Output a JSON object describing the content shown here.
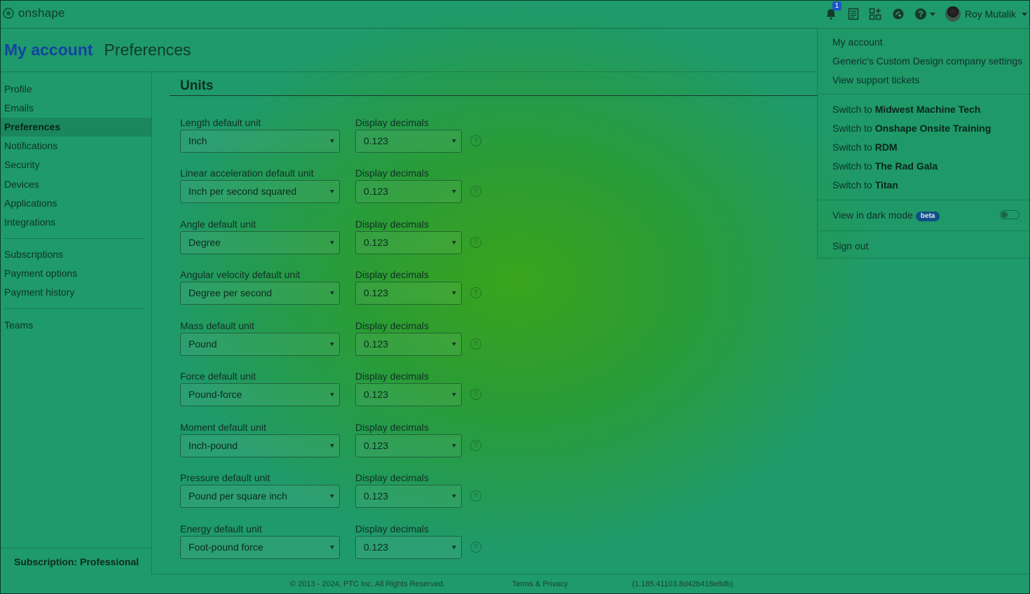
{
  "app": {
    "logo_text": "onshape"
  },
  "topbar": {
    "notification_count": "1",
    "user_name": "Roy Mutalik",
    "icons": [
      "bell-icon",
      "document-list-icon",
      "app-store-icon",
      "learning-center-icon",
      "help-icon",
      "user-avatar"
    ]
  },
  "header": {
    "title": "My account",
    "subtitle": "Preferences"
  },
  "sidebar": {
    "groups": [
      [
        "Profile",
        "Emails",
        "Preferences",
        "Notifications",
        "Security",
        "Devices",
        "Applications",
        "Integrations"
      ],
      [
        "Subscriptions",
        "Payment options",
        "Payment history"
      ],
      [
        "Teams"
      ]
    ],
    "active": "Preferences",
    "subscription": "Subscription: Professional"
  },
  "units": {
    "title": "Units",
    "rows": [
      {
        "label": "Length default unit",
        "value": "Inch",
        "dec_label": "Display decimals",
        "decimals": "0.123"
      },
      {
        "label": "Linear acceleration default unit",
        "value": "Inch per second squared",
        "dec_label": "Display decimals",
        "decimals": "0.123"
      },
      {
        "label": "Angle default unit",
        "value": "Degree",
        "dec_label": "Display decimals",
        "decimals": "0.123"
      },
      {
        "label": "Angular velocity default unit",
        "value": "Degree per second",
        "dec_label": "Display decimals",
        "decimals": "0.123"
      },
      {
        "label": "Mass default unit",
        "value": "Pound",
        "dec_label": "Display decimals",
        "decimals": "0.123"
      },
      {
        "label": "Force default unit",
        "value": "Pound-force",
        "dec_label": "Display decimals",
        "decimals": "0.123"
      },
      {
        "label": "Moment default unit",
        "value": "Inch-pound",
        "dec_label": "Display decimals",
        "decimals": "0.123"
      },
      {
        "label": "Pressure default unit",
        "value": "Pound per square inch",
        "dec_label": "Display decimals",
        "decimals": "0.123"
      },
      {
        "label": "Energy default unit",
        "value": "Foot-pound force",
        "dec_label": "Display decimals",
        "decimals": "0.123"
      }
    ]
  },
  "menu": {
    "my_account": "My account",
    "company_settings": "Generic's Custom Design company settings",
    "support_tickets": "View support tickets",
    "switch_prefix": "Switch to",
    "switch_targets": [
      "Midwest Machine Tech",
      "Onshape Onsite Training",
      "RDM",
      "The Rad Gala",
      "Titan"
    ],
    "dark_mode": "View in dark mode",
    "beta": "beta",
    "dark_mode_on": false,
    "sign_out": "Sign out"
  },
  "footer": {
    "copyright": "© 2013 - 2024, PTC Inc. All Rights Reserved.",
    "terms": "Terms & Privacy",
    "version": "(1.185.41103.8d42b418e8db)"
  },
  "colors": {
    "brand_blue": "#1244a0",
    "beta_badge": "#124f86",
    "overlay_green": "#2a9c36"
  }
}
